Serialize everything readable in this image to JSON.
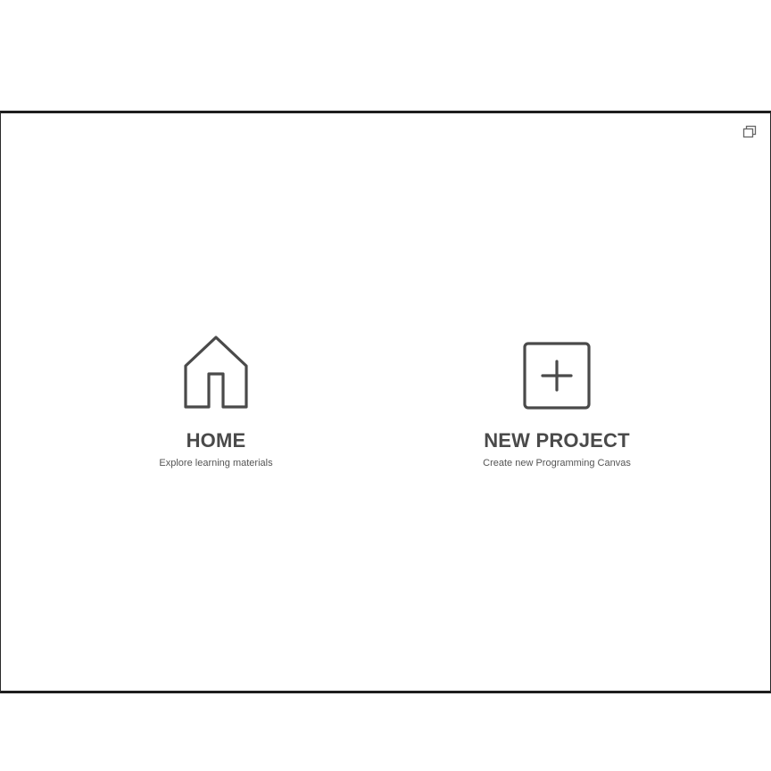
{
  "toolbar": {
    "window_icon": "restore-window-icon"
  },
  "options": {
    "home": {
      "title": "HOME",
      "subtitle": "Explore learning materials",
      "icon": "house-icon"
    },
    "new_project": {
      "title": "NEW PROJECT",
      "subtitle": "Create new Programming Canvas",
      "icon": "plus-square-icon"
    }
  },
  "colors": {
    "frame_border": "#1e1e1e",
    "icon_stroke": "#4a4a4a",
    "title_text": "#4a4a4a",
    "background": "#ffffff"
  }
}
